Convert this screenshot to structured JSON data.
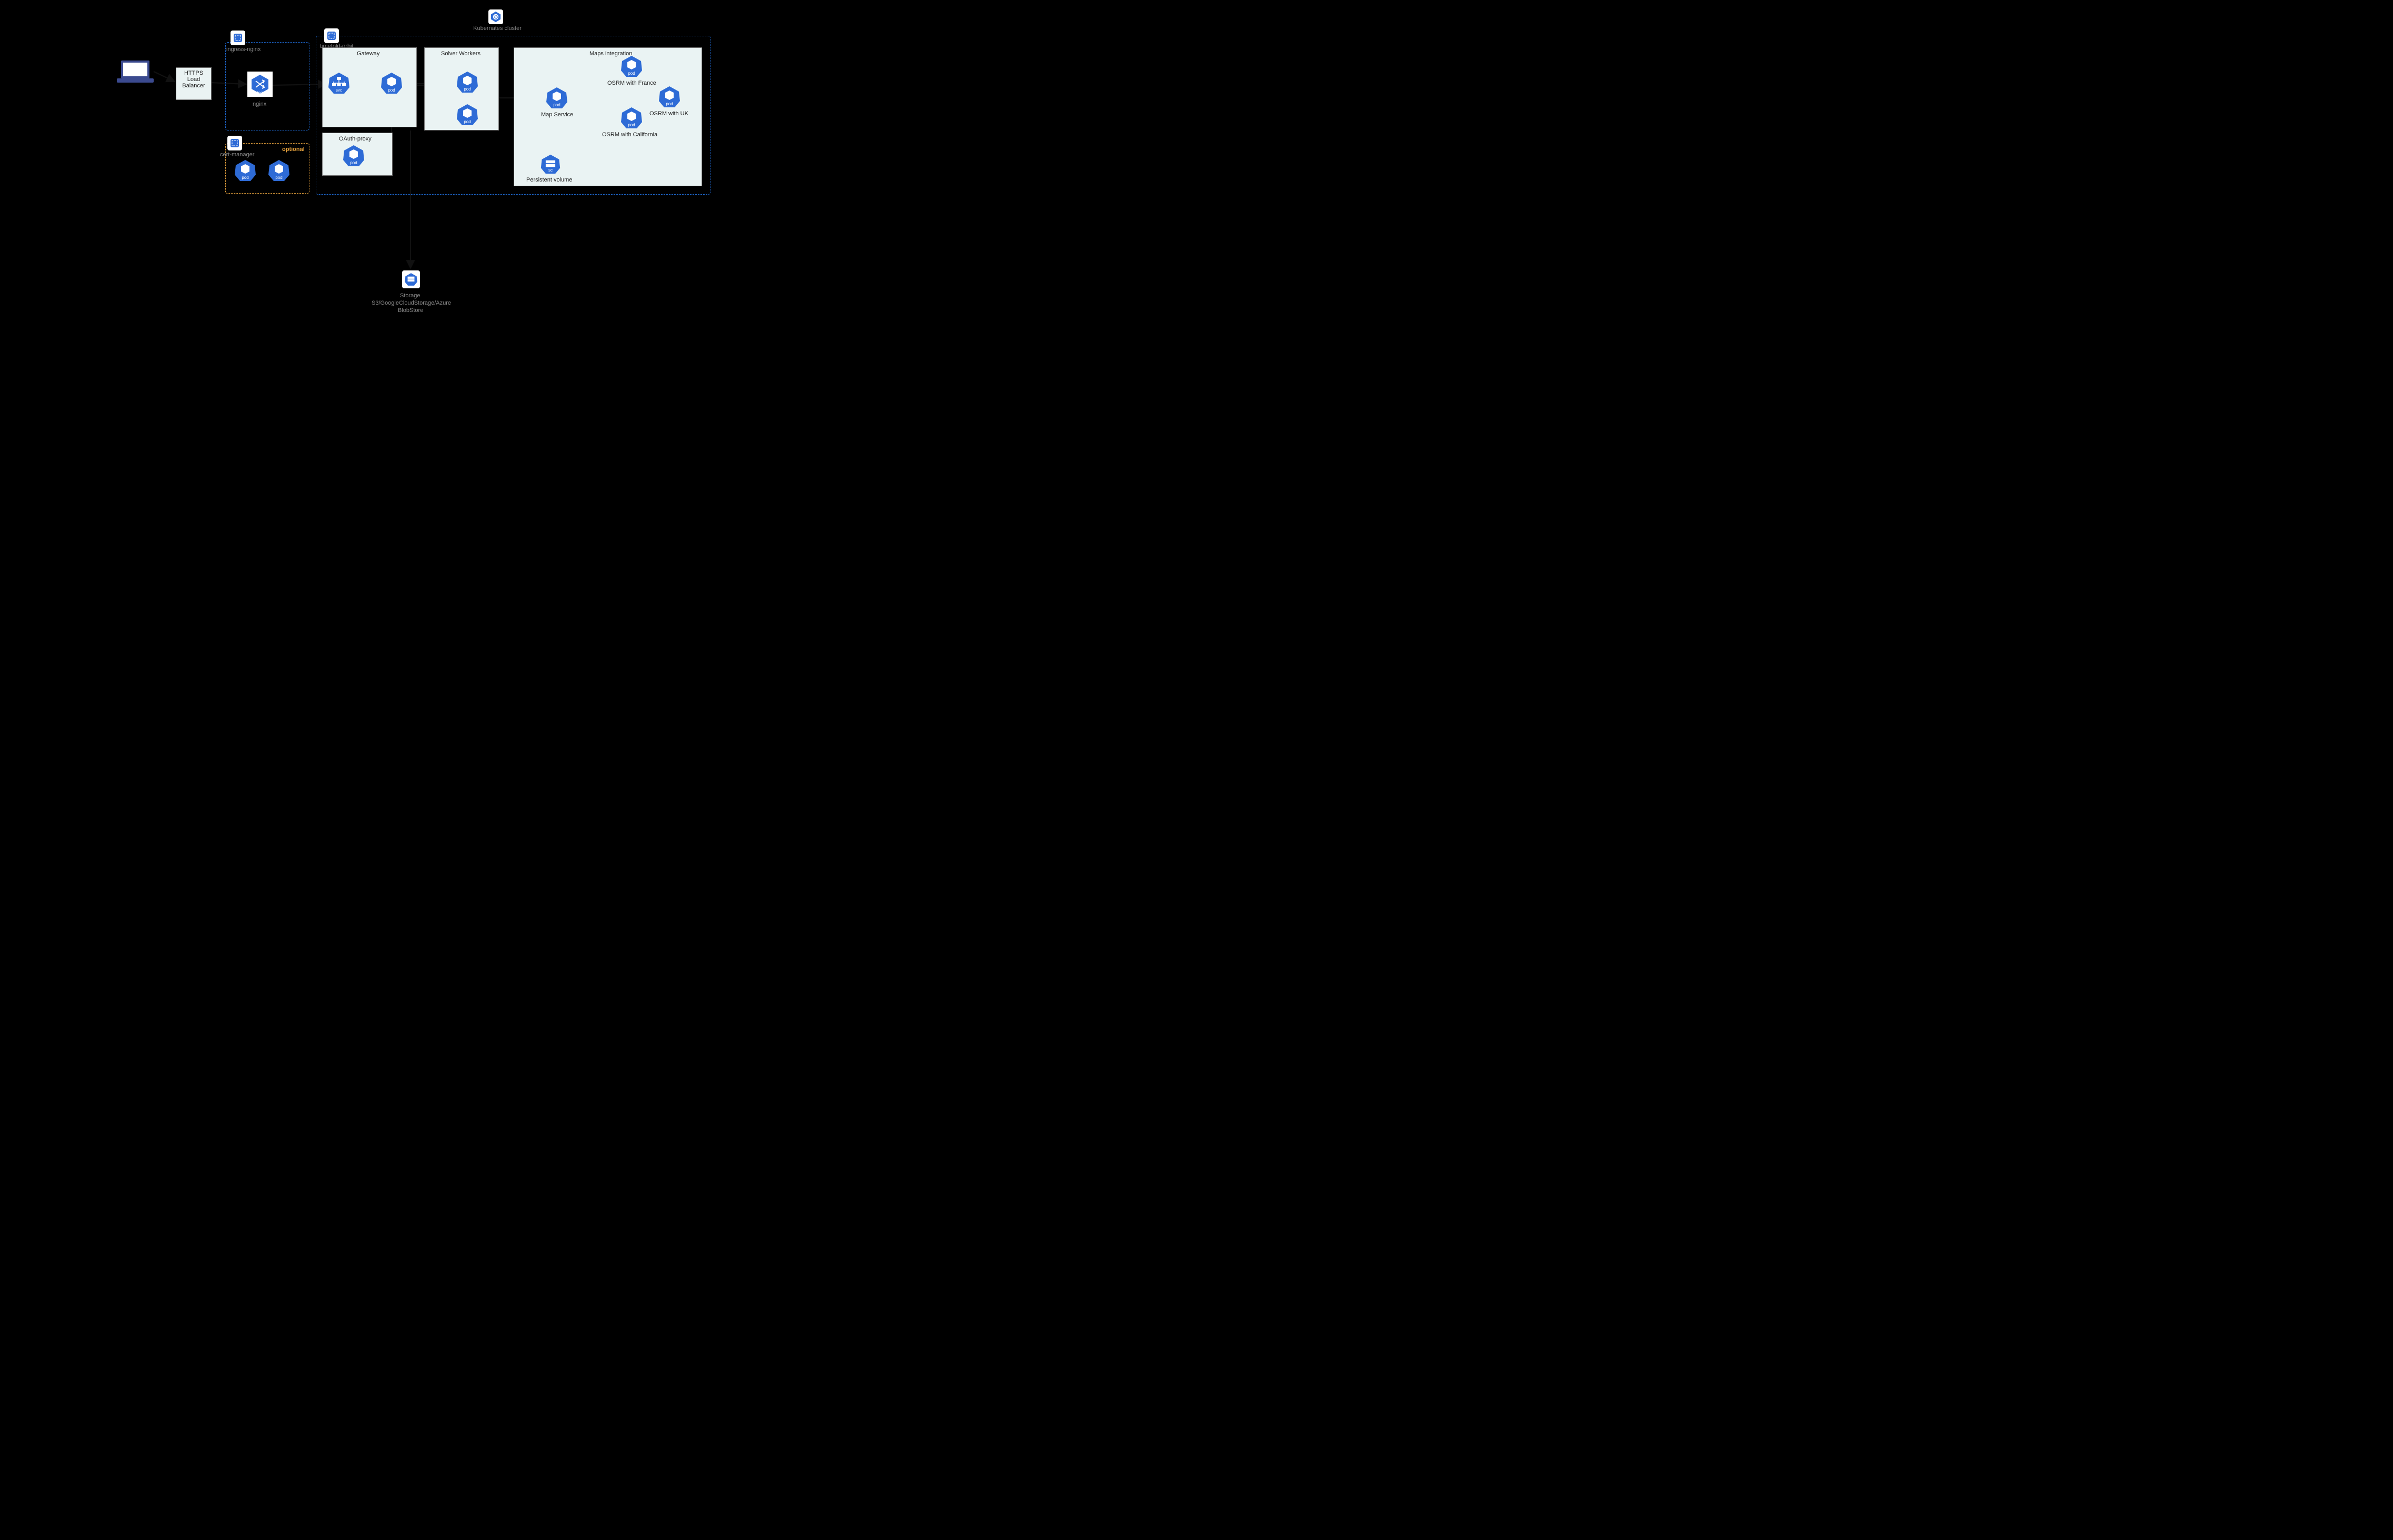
{
  "cluster_label": "Kubernates cluster",
  "ns_ingress": "ingress-nginx",
  "ns_timefold": "timefold-orbit",
  "ns_cert": "cert-manager",
  "optional": "optional",
  "lb_line1": "HTTPS",
  "lb_line2": "Load",
  "lb_line3": "Balancer",
  "nginx": "nginx",
  "gateway": "Gateway",
  "solver": "Solver Workers",
  "maps": "Maps integration",
  "oauth": "OAuth-proxy",
  "mapservice": "Map Service",
  "osrm_fr": "OSRM with France",
  "osrm_uk": "OSRM with UK",
  "osrm_ca": "OSRM with California",
  "pv": "Persistent volume",
  "storage1": "Storage",
  "storage2": "S3/GoogleCloudStorage/Azure",
  "storage3": "BlobStore",
  "svc": "svc",
  "pod": "pod",
  "ing": "ing",
  "sc": "sc",
  "ns": "ns"
}
